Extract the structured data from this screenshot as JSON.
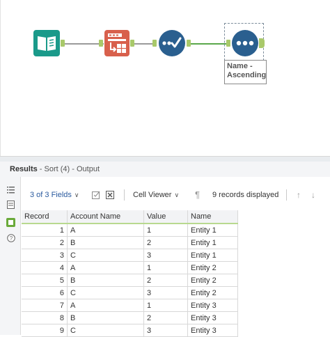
{
  "canvas": {
    "tools": [
      {
        "name": "input-data-tool",
        "icon": "book-icon",
        "color": "#1a9a8a"
      },
      {
        "name": "text-to-columns-tool",
        "icon": "text-to-columns-icon",
        "color": "#d8604c"
      },
      {
        "name": "select-tool",
        "icon": "checkmark-icon",
        "color": "#2a5f8f"
      },
      {
        "name": "sort-tool",
        "icon": "dots-icon",
        "color": "#2a5f8f"
      }
    ],
    "selected_tool_label": "Name -\nAscending"
  },
  "results": {
    "title": "Results",
    "subtitle": " - Sort (4) - Output"
  },
  "toolbar": {
    "fields_label": "3 of 3 Fields",
    "viewer_label": "Cell Viewer",
    "records_label": "9 records displayed"
  },
  "table": {
    "columns": [
      "Record",
      "Account Name",
      "Value",
      "Name"
    ],
    "rows": [
      [
        "1",
        "A",
        "1",
        "Entity 1"
      ],
      [
        "2",
        "B",
        "2",
        "Entity 1"
      ],
      [
        "3",
        "C",
        "3",
        "Entity 1"
      ],
      [
        "4",
        "A",
        "1",
        "Entity 2"
      ],
      [
        "5",
        "B",
        "2",
        "Entity 2"
      ],
      [
        "6",
        "C",
        "3",
        "Entity 2"
      ],
      [
        "7",
        "A",
        "1",
        "Entity 3"
      ],
      [
        "8",
        "B",
        "2",
        "Entity 3"
      ],
      [
        "9",
        "C",
        "3",
        "Entity 3"
      ]
    ]
  },
  "colors": {
    "accent_green": "#a9c96a",
    "link_blue": "#2a5a9e"
  }
}
